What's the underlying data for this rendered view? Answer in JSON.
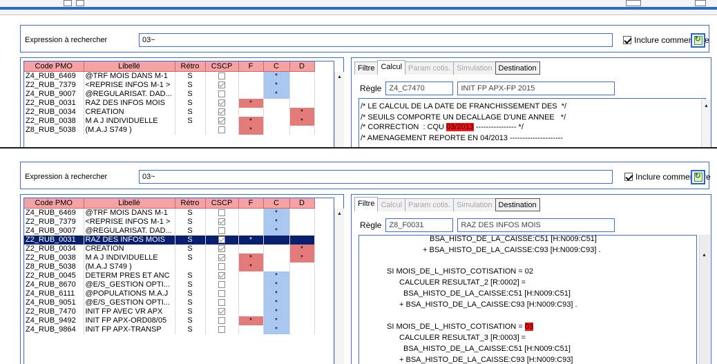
{
  "search": {
    "label": "Expression à rechercher",
    "value": "03~",
    "include_comment": "Inclure commentaire"
  },
  "columns": {
    "code": "Code PMO",
    "libelle": "Libellé",
    "retro": "Rétro",
    "cscp": "CSCP",
    "f": "F",
    "c": "C",
    "d": "D"
  },
  "tabs": {
    "filtre": "Filtre",
    "calcul": "Calcul",
    "param": "Param cotis.",
    "simulation": "Simulation",
    "destination": "Destination"
  },
  "top": {
    "rows": [
      {
        "code": "Z4_RUB_6469",
        "libelle": "@TRF MOIS DANS M-1",
        "retro": "S",
        "cscp": false,
        "f": "",
        "c": "*",
        "d": ""
      },
      {
        "code": "Z2_RUB_7379",
        "libelle": "<REPRISE INFOS M-1 >",
        "retro": "S",
        "cscp": true,
        "f": "",
        "c": "*",
        "d": ""
      },
      {
        "code": "Z4_RUB_9007",
        "libelle": "@REGULARISAT. DAD...",
        "retro": "S",
        "cscp": false,
        "f": "",
        "c": "*",
        "d": ""
      },
      {
        "code": "Z2_RUB_0031",
        "libelle": "RAZ DES INFOS MOIS",
        "retro": "S",
        "cscp": true,
        "f": "*",
        "c": "",
        "d": ""
      },
      {
        "code": "Z2_RUB_0034",
        "libelle": "CREATION",
        "retro": "S",
        "cscp": true,
        "f": "",
        "c": "",
        "d": "*"
      },
      {
        "code": "Z2_RUB_0038",
        "libelle": "M A J  INDIVIDUELLE",
        "retro": "S",
        "cscp": true,
        "f": "*",
        "c": "",
        "d": "*"
      },
      {
        "code": "Z8_RUB_5038",
        "libelle": "(M.A.J S749      )",
        "retro": "",
        "cscp": false,
        "f": "*",
        "c": "",
        "d": ""
      }
    ],
    "rule": {
      "label": "Règle",
      "code": "Z4_C7470",
      "name": "INIT FP APX-FP 2015"
    },
    "code_lines": [
      {
        "pre": "/* LE CALCUL DE LA DATE DE FRANCHISSEMENT DES  */",
        "hl": "",
        "post": ""
      },
      {
        "pre": "/* SEUILS COMPORTE UN DECALLAGE D'UNE ANNEE   */",
        "hl": "",
        "post": ""
      },
      {
        "pre": "/* CORRECTION  : CQU ",
        "hl": "03/2013",
        "post": " ---------------- */"
      },
      {
        "pre": "/* AMENAGEMENT REPORTE EN 04/2013 ---------------------",
        "hl": "",
        "post": ""
      }
    ]
  },
  "bottom": {
    "rows": [
      {
        "code": "Z4_RUB_6469",
        "libelle": "@TRF MOIS DANS M-1",
        "retro": "S",
        "cscp": false,
        "f": "",
        "c": "*",
        "d": ""
      },
      {
        "code": "Z2_RUB_7379",
        "libelle": "<REPRISE INFOS M-1 >",
        "retro": "S",
        "cscp": true,
        "f": "",
        "c": "*",
        "d": ""
      },
      {
        "code": "Z4_RUB_9007",
        "libelle": "@REGULARISAT. DAD...",
        "retro": "S",
        "cscp": false,
        "f": "",
        "c": "*",
        "d": ""
      },
      {
        "code": "Z2_RUB_0031",
        "libelle": "RAZ DES INFOS MOIS",
        "retro": "S",
        "cscp": true,
        "f": "*",
        "c": "",
        "d": "",
        "selected": true
      },
      {
        "code": "Z2_RUB_0034",
        "libelle": "CREATION",
        "retro": "S",
        "cscp": true,
        "f": "",
        "c": "",
        "d": "*"
      },
      {
        "code": "Z2_RUB_0038",
        "libelle": "M A J  INDIVIDUELLE",
        "retro": "S",
        "cscp": true,
        "f": "*",
        "c": "",
        "d": "*"
      },
      {
        "code": "Z8_RUB_5038",
        "libelle": "(M.A.J S749      )",
        "retro": "",
        "cscp": false,
        "f": "*",
        "c": "",
        "d": ""
      },
      {
        "code": "Z2_RUB_0045",
        "libelle": "DETERM PRES ET ANC",
        "retro": "S",
        "cscp": true,
        "f": "",
        "c": "*",
        "d": ""
      },
      {
        "code": "Z4_RUB_8670",
        "libelle": "@E/S_GESTION OPTI...",
        "retro": "S",
        "cscp": false,
        "f": "",
        "c": "*",
        "d": ""
      },
      {
        "code": "Z4_RUB_6111",
        "libelle": "@POPULATIONS M.A.J",
        "retro": "S",
        "cscp": false,
        "f": "",
        "c": "*",
        "d": ""
      },
      {
        "code": "Z4_RUB_9051",
        "libelle": "@E/S_GESTION OPTI...",
        "retro": "S",
        "cscp": false,
        "f": "",
        "c": "*",
        "d": ""
      },
      {
        "code": "Z2_RUB_7470",
        "libelle": "INIT FP AVEC VR APX",
        "retro": "S",
        "cscp": true,
        "f": "",
        "c": "*",
        "d": ""
      },
      {
        "code": "Z4_RUB_9492",
        "libelle": "INIT FP APX-ORD08/05",
        "retro": "S",
        "cscp": false,
        "f": "*",
        "c": "*",
        "d": ""
      },
      {
        "code": "Z4_RUB_9864",
        "libelle": "INIT FP APX-TRANSP",
        "retro": "S",
        "cscp": false,
        "f": "",
        "c": "*",
        "d": ""
      }
    ],
    "rule": {
      "label": "Règle",
      "code": "Z8_F0031",
      "name": "RAZ DES INFOS MOIS"
    },
    "code_lines": [
      {
        "pre": "BSA_HISTO_DE_LA_CAISSE:C51 [H:N009:C51]",
        "hl": "",
        "post": ""
      },
      {
        "pre": "+ BSA_HISTO_DE_LA_CAISSE:C93 [H:N009:C93] .",
        "hl": "",
        "post": ""
      },
      {
        "pre": "SI MOIS_DE_L_HISTO_COTISATION = 02",
        "hl": "",
        "post": ""
      },
      {
        "pre": "CALCULER RESULTAT_2 [R:0002] =",
        "hl": "",
        "post": ""
      },
      {
        "pre": "BSA_HISTO_DE_LA_CAISSE:C51 [H:N009:C51]",
        "hl": "",
        "post": ""
      },
      {
        "pre": "+ BSA_HISTO_DE_LA_CAISSE:C93 [H:N009:C93] .",
        "hl": "",
        "post": ""
      },
      {
        "pre": "SI MOIS_DE_L_HISTO_COTISATION = ",
        "hl": "03",
        "post": ""
      },
      {
        "pre": "CALCULER RESULTAT_3 [R:0003] =",
        "hl": "",
        "post": ""
      },
      {
        "pre": "BSA_HISTO_DE_LA_CAISSE:C51 [H:N009:C51]",
        "hl": "",
        "post": ""
      },
      {
        "pre": "+ BSA_HISTO_DE_LA_CAISSE:C93 [H:N009:C93]",
        "hl": "",
        "post": ""
      }
    ]
  }
}
